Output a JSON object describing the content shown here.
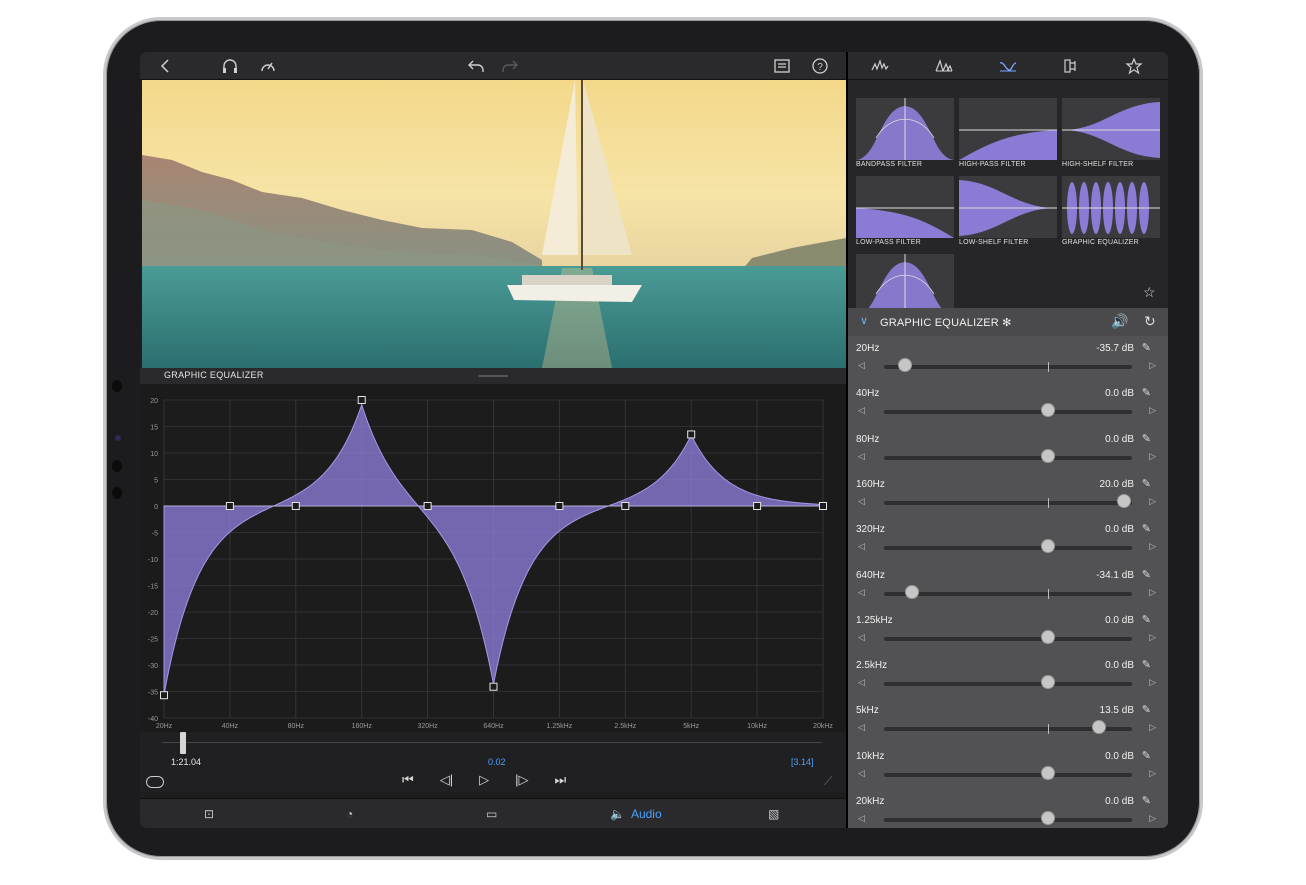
{
  "editor": {
    "section_label": "GRAPHIC EQUALIZER",
    "timecode": "1:21.04",
    "playhead_value": "0.02",
    "duration": "[3.14]",
    "bottom_tabs": {
      "audio_label": "Audio"
    }
  },
  "eq_graph": {
    "y_ticks": [
      "20",
      "15",
      "10",
      "5",
      "0",
      "-5",
      "-10",
      "-15",
      "-20",
      "-25",
      "-30",
      "-35",
      "-40"
    ],
    "x_ticks": [
      "20Hz",
      "40Hz",
      "80Hz",
      "160Hz",
      "320Hz",
      "640Hz",
      "1.25kHz",
      "2.5kHz",
      "5kHz",
      "10kHz",
      "20kHz"
    ],
    "gains_db": [
      -35.7,
      0.0,
      0.0,
      20.0,
      0.0,
      -34.1,
      0.0,
      0.0,
      13.5,
      0.0,
      0.0
    ],
    "y_range": [
      -40,
      20
    ],
    "fill_color": "#8c7bd4"
  },
  "filters": [
    {
      "label": "BANDPASS FILTER",
      "icon": "bandpass-curve"
    },
    {
      "label": "HIGH-PASS FILTER",
      "icon": "highpass-curve"
    },
    {
      "label": "HIGH-SHELF FILTER",
      "icon": "highshelf-curve"
    },
    {
      "label": "LOW-PASS FILTER",
      "icon": "lowpass-curve"
    },
    {
      "label": "LOW-SHELF FILTER",
      "icon": "lowshelf-curve"
    },
    {
      "label": "GRAPHIC EQUALIZER",
      "icon": "graphic-eq-curve"
    },
    {
      "label": "",
      "icon": "bandpass-curve"
    }
  ],
  "effect_panel": {
    "title": "GRAPHIC EQUALIZER ✻",
    "bands": [
      {
        "name": "20Hz",
        "value": "-35.7 dB",
        "gain": -35.7
      },
      {
        "name": "40Hz",
        "value": "0.0 dB",
        "gain": 0.0
      },
      {
        "name": "80Hz",
        "value": "0.0 dB",
        "gain": 0.0
      },
      {
        "name": "160Hz",
        "value": "20.0 dB",
        "gain": 20.0
      },
      {
        "name": "320Hz",
        "value": "0.0 dB",
        "gain": 0.0
      },
      {
        "name": "640Hz",
        "value": "-34.1 dB",
        "gain": -34.1
      },
      {
        "name": "1.25kHz",
        "value": "0.0 dB",
        "gain": 0.0
      },
      {
        "name": "2.5kHz",
        "value": "0.0 dB",
        "gain": 0.0
      },
      {
        "name": "5kHz",
        "value": "13.5 dB",
        "gain": 13.5
      },
      {
        "name": "10kHz",
        "value": "0.0 dB",
        "gain": 0.0
      },
      {
        "name": "20kHz",
        "value": "0.0 dB",
        "gain": 0.0
      }
    ]
  },
  "colors": {
    "accent": "#4aa3ff",
    "eq_purple": "#8c7bd4"
  }
}
